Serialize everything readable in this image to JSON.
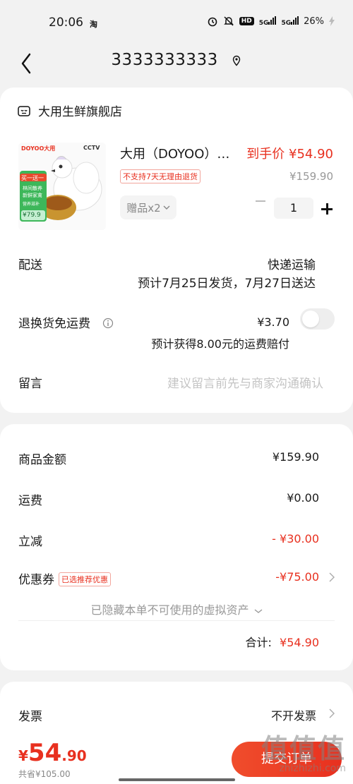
{
  "status": {
    "time": "20:06",
    "app_icon": "淘",
    "hd": "HD",
    "net1": "5G",
    "net2": "5G",
    "battery": "26%"
  },
  "header": {
    "phone": "3333333333",
    "icons": [
      "back-arrow-icon",
      "location-pin-icon"
    ]
  },
  "shop": {
    "name": "大用生鲜旗舰店",
    "icon": "shop-face-icon"
  },
  "product": {
    "title": "大用（DOYOO）…",
    "price_label": "到手价 ¥54.90",
    "tag": "不支持7天无理由退货",
    "original_price": "¥159.90",
    "gift": "赠品x2",
    "quantity": "1",
    "image": {
      "brand": "DOYOO大用",
      "corner": "CCTV",
      "badge": "买一送一",
      "line1": "林间散养",
      "line2": "新鲜家禽",
      "line3": "营养滋补",
      "price": "¥79.9"
    }
  },
  "delivery": {
    "label": "配送",
    "method": "快递运输",
    "eta": "预计7月25日发货，7月27日送达"
  },
  "return_insurance": {
    "label": "退换货免运费",
    "price": "¥3.70",
    "note": "预计获得8.00元的运费赔付",
    "enabled": false
  },
  "message": {
    "label": "留言",
    "placeholder": "建议留言前先与商家沟通确认"
  },
  "summary": {
    "goods_label": "商品金额",
    "goods_value": "¥159.90",
    "freight_label": "运费",
    "freight_value": "¥0.00",
    "discount_label": "立减",
    "discount_value": "- ¥30.00",
    "coupon_label": "优惠券",
    "coupon_tag": "已选推荐优惠",
    "coupon_value": "-¥75.00",
    "hidden_note": "已隐藏本单不可使用的虚拟资产",
    "total_label": "合计:",
    "total_value": "¥54.90"
  },
  "invoice": {
    "label": "发票",
    "value": "不开发票"
  },
  "footer": {
    "currency": "¥",
    "amount_int": "54",
    "amount_dec": ".90",
    "sub": "共省¥105.00",
    "submit": "提交订单"
  },
  "watermark": {
    "line1": "值值值",
    "line2": "zhizhizhi.com"
  },
  "colors": {
    "accent": "#e8301f",
    "background": "#f2f2f2",
    "card": "#ffffff"
  }
}
